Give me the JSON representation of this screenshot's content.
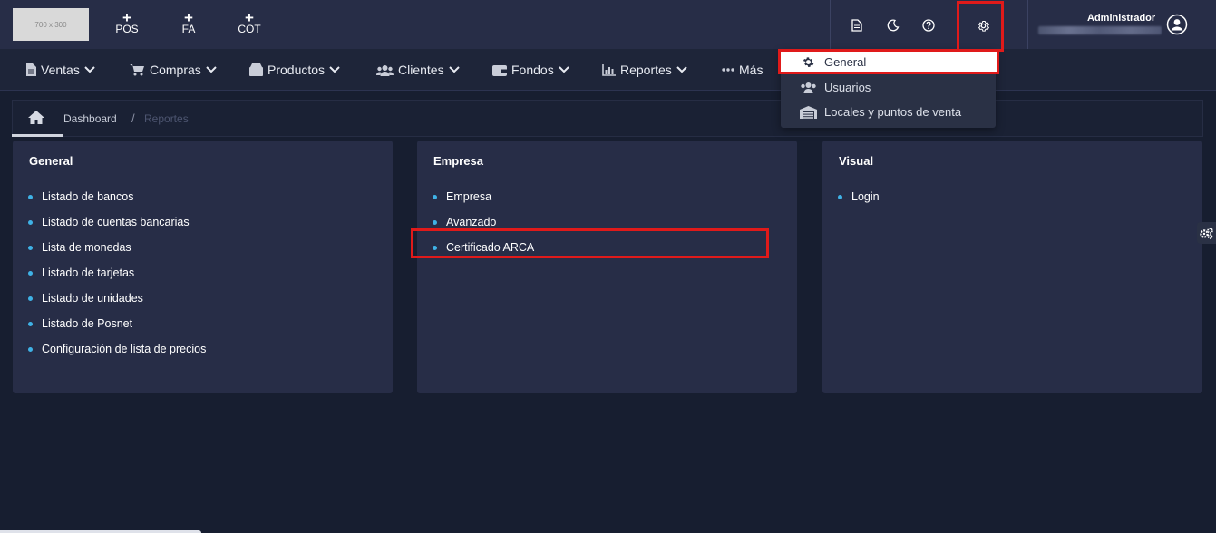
{
  "topbar": {
    "logo_text": "700 x 300",
    "quick_actions": [
      {
        "plus": "+",
        "label": "POS"
      },
      {
        "plus": "+",
        "label": "FA"
      },
      {
        "plus": "+",
        "label": "COT"
      }
    ],
    "icons": [
      "document-icon",
      "moon-icon",
      "help-icon",
      "gear-icon"
    ],
    "user_name": "Administrador"
  },
  "mainmenu": {
    "items": [
      {
        "label": "Ventas",
        "icon": "file-icon"
      },
      {
        "label": "Compras",
        "icon": "cart-icon"
      },
      {
        "label": "Productos",
        "icon": "box-icon"
      },
      {
        "label": "Clientes",
        "icon": "users-icon"
      },
      {
        "label": "Fondos",
        "icon": "wallet-icon"
      },
      {
        "label": "Reportes",
        "icon": "chart-icon"
      },
      {
        "label": "Más",
        "icon": "dots-icon"
      }
    ]
  },
  "breadcrumb": {
    "items": [
      "Dashboard",
      "Reportes"
    ],
    "separator": "/"
  },
  "cards": [
    {
      "title": "General",
      "links": [
        "Listado de bancos",
        "Listado de cuentas bancarias",
        "Lista de monedas",
        "Listado de tarjetas",
        "Listado de unidades",
        "Listado de Posnet",
        "Configuración de lista de precios"
      ]
    },
    {
      "title": "Empresa",
      "links": [
        "Empresa",
        "Avanzado",
        "Certificado ARCA"
      ]
    },
    {
      "title": "Visual",
      "links": [
        "Login"
      ]
    }
  ],
  "settings_dropdown": {
    "items": [
      {
        "label": "General",
        "icon": "gear-icon",
        "active": true
      },
      {
        "label": "Usuarios",
        "icon": "users-icon",
        "active": false
      },
      {
        "label": "Locales y puntos de venta",
        "icon": "warehouse-icon",
        "active": false
      }
    ]
  },
  "colors": {
    "background": "#171e30",
    "topbar": "#272d47",
    "card": "#272d47",
    "bullet": "#3fb2e6",
    "highlight": "#e01a1a"
  }
}
